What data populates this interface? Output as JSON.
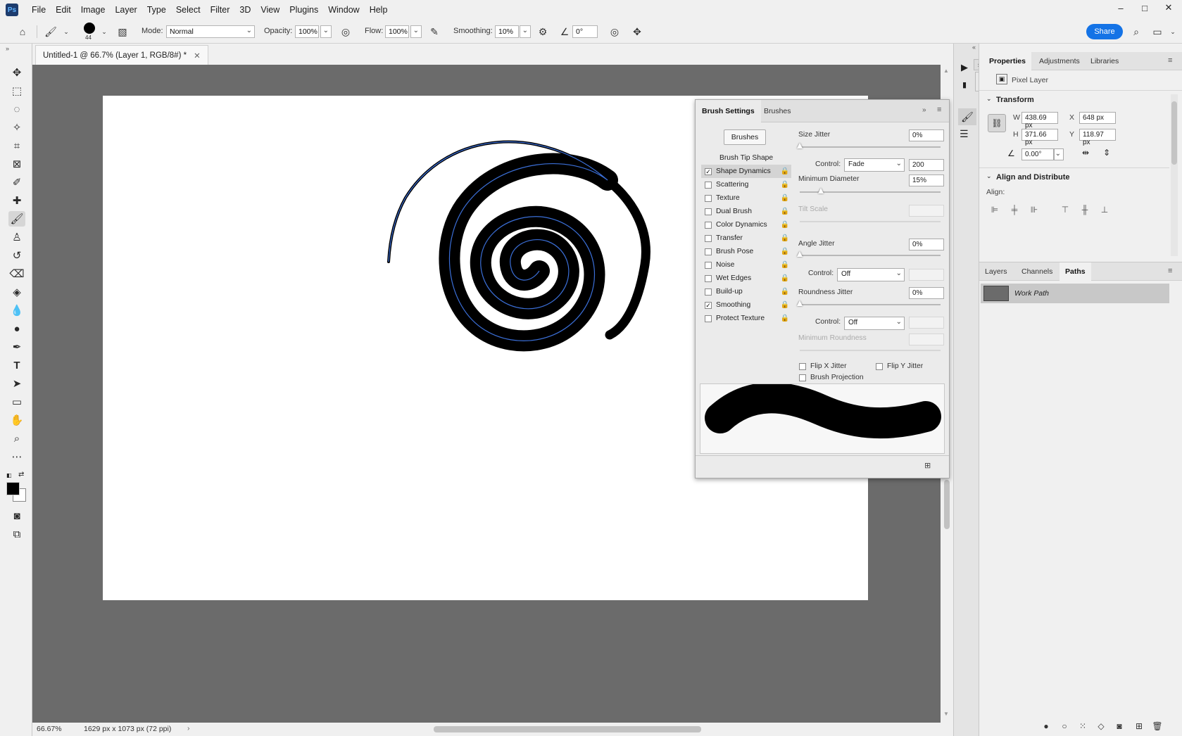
{
  "app": {
    "logo": "Ps"
  },
  "menu": [
    "File",
    "Edit",
    "Image",
    "Layer",
    "Type",
    "Select",
    "Filter",
    "3D",
    "View",
    "Plugins",
    "Window",
    "Help"
  ],
  "window_controls": {
    "minimize": "–",
    "maximize": "□",
    "close": "✕"
  },
  "options": {
    "brush_size": "44",
    "mode_label": "Mode:",
    "mode_value": "Normal",
    "opacity_label": "Opacity:",
    "opacity_value": "100%",
    "flow_label": "Flow:",
    "flow_value": "100%",
    "smoothing_label": "Smoothing:",
    "smoothing_value": "10%",
    "angle_value": "0°",
    "share_label": "Share"
  },
  "document": {
    "tab_title": "Untitled-1 @ 66.7% (Layer 1, RGB/8#) *",
    "zoom": "66.67%",
    "dimensions": "1629 px x 1073 px (72 ppi)"
  },
  "brush_settings": {
    "tabs": [
      "Brush Settings",
      "Brushes"
    ],
    "brushes_button": "Brushes",
    "brush_tip_shape": "Brush Tip Shape",
    "items": [
      {
        "label": "Shape Dynamics",
        "checked": true,
        "selected": true
      },
      {
        "label": "Scattering",
        "checked": false
      },
      {
        "label": "Texture",
        "checked": false
      },
      {
        "label": "Dual Brush",
        "checked": false
      },
      {
        "label": "Color Dynamics",
        "checked": false
      },
      {
        "label": "Transfer",
        "checked": false
      },
      {
        "label": "Brush Pose",
        "checked": false
      },
      {
        "label": "Noise",
        "checked": false
      },
      {
        "label": "Wet Edges",
        "checked": false
      },
      {
        "label": "Build-up",
        "checked": false
      },
      {
        "label": "Smoothing",
        "checked": true
      },
      {
        "label": "Protect Texture",
        "checked": false
      }
    ],
    "size_jitter_label": "Size Jitter",
    "size_jitter_value": "0%",
    "control_label": "Control:",
    "size_control_value": "Fade",
    "fade_steps": "200",
    "min_diameter_label": "Minimum Diameter",
    "min_diameter_value": "15%",
    "tilt_scale_label": "Tilt Scale",
    "angle_jitter_label": "Angle Jitter",
    "angle_jitter_value": "0%",
    "angle_control_value": "Off",
    "roundness_jitter_label": "Roundness Jitter",
    "roundness_jitter_value": "0%",
    "roundness_control_value": "Off",
    "min_roundness_label": "Minimum Roundness",
    "flip_x_label": "Flip X Jitter",
    "flip_y_label": "Flip Y Jitter",
    "projection_label": "Brush Projection"
  },
  "properties": {
    "tabs": [
      "Properties",
      "Adjustments",
      "Libraries"
    ],
    "layer_kind": "Pixel Layer",
    "transform_title": "Transform",
    "w_label": "W",
    "w_value": "438.69 px",
    "h_label": "H",
    "h_value": "371.66 px",
    "x_label": "X",
    "x_value": "648 px",
    "y_label": "Y",
    "y_value": "118.97 px",
    "angle_value": "0.00°",
    "align_title": "Align and Distribute",
    "align_label": "Align:"
  },
  "layers_panel": {
    "tabs": [
      "Layers",
      "Channels",
      "Paths"
    ],
    "path_name": "Work Path"
  }
}
